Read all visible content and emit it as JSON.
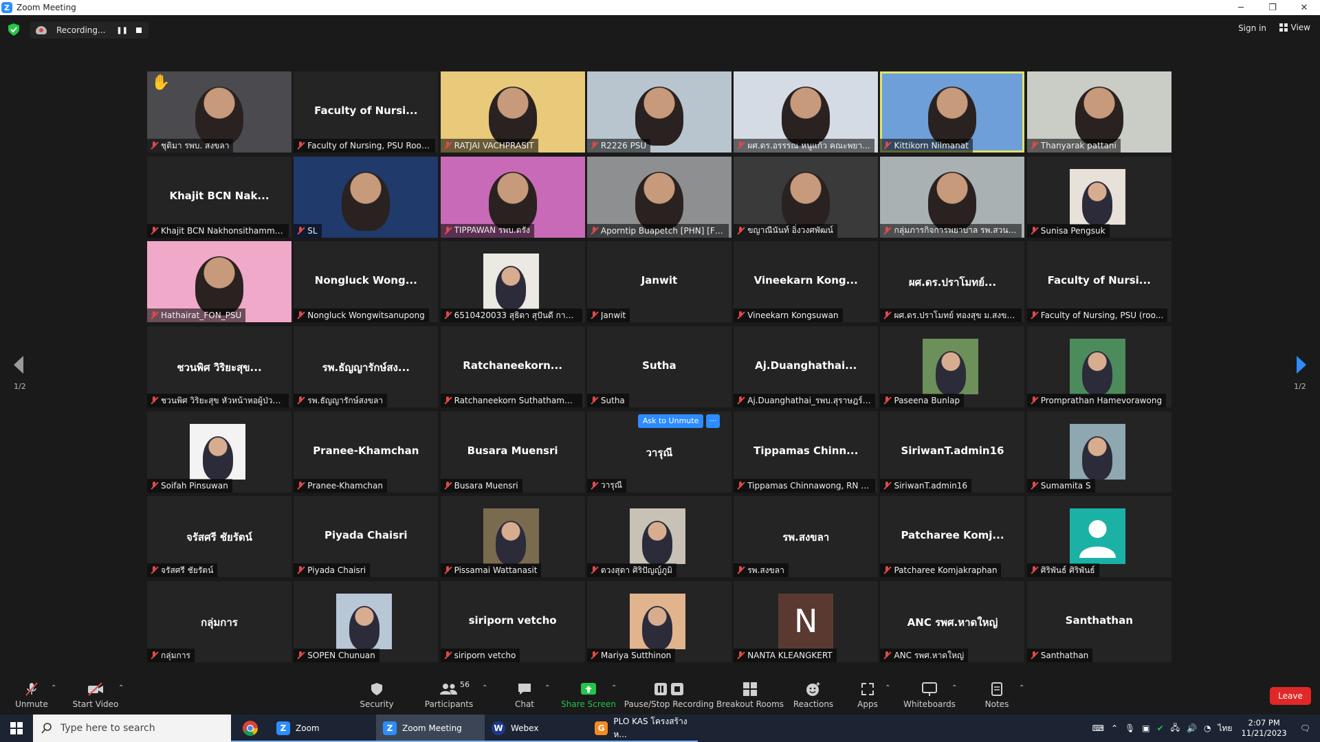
{
  "window": {
    "title": "Zoom Meeting",
    "controls": [
      "─",
      "❐",
      "✕"
    ]
  },
  "topbar": {
    "recording_label": "Recording...",
    "sign_in": "Sign in",
    "view": "View"
  },
  "tiles": [
    {
      "big": "",
      "label": "ชุติมา รพบ. สงขลา",
      "bg": "#4b4a4f",
      "kind": "video"
    },
    {
      "big": "Faculty of Nursi...",
      "label": "Faculty of Nursing, PSU Room...",
      "bg": "#242424",
      "kind": "name"
    },
    {
      "big": "",
      "label": "RATJAI VACHPRASIT",
      "bg": "#e9c97a",
      "kind": "video"
    },
    {
      "big": "",
      "label": "R2226 PSU",
      "bg": "#b8c5ce",
      "kind": "video"
    },
    {
      "big": "",
      "label": "ผศ.ดร.อรรรณ หนูแก้ว คณะพยา...",
      "bg": "#d5dbe5",
      "kind": "video"
    },
    {
      "big": "",
      "label": "Kittikorn Nilmanat",
      "bg": "#6f9fd8",
      "kind": "video",
      "active": true
    },
    {
      "big": "",
      "label": "Thanyarak pattani",
      "bg": "#c9cdc6",
      "kind": "video"
    },
    {
      "big": "Khajit BCN Nak...",
      "label": "Khajit BCN Nakhonsithammarat",
      "bg": "#242424",
      "kind": "name"
    },
    {
      "big": "",
      "label": "SL",
      "bg": "#1f3a6b",
      "kind": "video"
    },
    {
      "big": "",
      "label": "TIPPAWAN รพบ.ตรัง",
      "bg": "#c86ab7",
      "kind": "video"
    },
    {
      "big": "",
      "label": "Aporntip Buapetch [PHN] [FO...",
      "bg": "#8d8f90",
      "kind": "video"
    },
    {
      "big": "",
      "label": "ขญาณีนันท์ อิ่งวงศพัฒน์",
      "bg": "#3a3a3a",
      "kind": "video"
    },
    {
      "big": "",
      "label": "กลุ่มภารกิจการพยาบาล รพ.สวนสร...",
      "bg": "#a9b1b3",
      "kind": "video"
    },
    {
      "big": "",
      "label": "Sunisa Pengsuk",
      "bg": "#242424",
      "kind": "photo",
      "pbg": "#e7e1da"
    },
    {
      "big": "",
      "label": "Hathairat_FON_PSU",
      "bg": "#f0a9c8",
      "kind": "video"
    },
    {
      "big": "Nongluck Wong...",
      "label": "Nongluck Wongwitsanupong",
      "bg": "#242424",
      "kind": "name"
    },
    {
      "big": "",
      "label": "6510420033 สุธิดา สุปันดี การผดุ...",
      "bg": "#242424",
      "kind": "photo",
      "pbg": "#ece8e2"
    },
    {
      "big": "Janwit",
      "label": "Janwit",
      "bg": "#242424",
      "kind": "name"
    },
    {
      "big": "Vineekarn Kong...",
      "label": "Vineekarn Kongsuwan",
      "bg": "#242424",
      "kind": "name"
    },
    {
      "big": "ผศ.ดร.ปราโมทย์...",
      "label": "ผศ.ดร.ปราโมทย์ ทองสุข ม.สงขลาน...",
      "bg": "#242424",
      "kind": "name"
    },
    {
      "big": "Faculty of Nursi...",
      "label": "Faculty of Nursing, PSU (roo...",
      "bg": "#242424",
      "kind": "name"
    },
    {
      "big": "ชวนพิศ วิริยะสุข...",
      "label": "ชวนพิศ วิริยะสุข หัวหน้าหอผู้ป่วยเ...",
      "bg": "#242424",
      "kind": "name"
    },
    {
      "big": "รพ.ธัญญารักษ์สง...",
      "label": "รพ.ธัญญารักษ์สงขลา",
      "bg": "#242424",
      "kind": "name"
    },
    {
      "big": "Ratchaneekorn...",
      "label": "Ratchaneekorn Suthathammar...",
      "bg": "#242424",
      "kind": "name"
    },
    {
      "big": "Sutha",
      "label": "Sutha",
      "bg": "#242424",
      "kind": "name"
    },
    {
      "big": "Aj.Duanghathai...",
      "label": "Aj.Duanghathai_รพบ.สุราษฎร์ธานี",
      "bg": "#242424",
      "kind": "name"
    },
    {
      "big": "",
      "label": "Paseena Bunlap",
      "bg": "#242424",
      "kind": "photo",
      "pbg": "#6d8f5a"
    },
    {
      "big": "",
      "label": "Promprathan Hamevorawong",
      "bg": "#242424",
      "kind": "photo",
      "pbg": "#4c8c5c"
    },
    {
      "big": "",
      "label": "Soifah Pinsuwan",
      "bg": "#242424",
      "kind": "photo",
      "pbg": "#f3f3f3"
    },
    {
      "big": "Pranee-Khamchan",
      "label": "Pranee-Khamchan",
      "bg": "#242424",
      "kind": "name"
    },
    {
      "big": "Busara Muensri",
      "label": "Busara Muensri",
      "bg": "#242424",
      "kind": "name"
    },
    {
      "big": "วารุณี",
      "label": "วารุณี",
      "bg": "#242424",
      "kind": "name",
      "ask": true
    },
    {
      "big": "Tippamas Chinn...",
      "label": "Tippamas Chinnawong, RN P...",
      "bg": "#242424",
      "kind": "name"
    },
    {
      "big": "SiriwanT.admin16",
      "label": "SiriwanT.admin16",
      "bg": "#242424",
      "kind": "name"
    },
    {
      "big": "",
      "label": "Sumamita S",
      "bg": "#242424",
      "kind": "photo",
      "pbg": "#8fa7b0"
    },
    {
      "big": "จรัสศรี ชัยรัตน์",
      "label": "จรัสศรี ชัยรัตน์",
      "bg": "#242424",
      "kind": "name"
    },
    {
      "big": "Piyada Chaisri",
      "label": "Piyada Chaisri",
      "bg": "#242424",
      "kind": "name"
    },
    {
      "big": "",
      "label": "Pissamai Wattanasit",
      "bg": "#242424",
      "kind": "photo",
      "pbg": "#7a6b4f"
    },
    {
      "big": "",
      "label": "ดวงสุดา ศิริปัญญ์ภูมิ",
      "bg": "#242424",
      "kind": "photo",
      "pbg": "#c8c1b6"
    },
    {
      "big": "รพ.สงขลา",
      "label": "รพ.สงขลา",
      "bg": "#242424",
      "kind": "name"
    },
    {
      "big": "Patcharee Komj...",
      "label": "Patcharee Komjakraphan",
      "bg": "#242424",
      "kind": "name"
    },
    {
      "big": "",
      "label": "ศิริพันธ์ ศิริพันธ์",
      "bg": "#242424",
      "kind": "avatar"
    },
    {
      "big": "กลุ่มการ",
      "label": "กลุ่มการ",
      "bg": "#242424",
      "kind": "name"
    },
    {
      "big": "",
      "label": "SOPEN Chunuan",
      "bg": "#242424",
      "kind": "photo",
      "pbg": "#b8c7d6"
    },
    {
      "big": "siriporn vetcho",
      "label": "siriporn vetcho",
      "bg": "#242424",
      "kind": "name"
    },
    {
      "big": "",
      "label": "Mariya Sutthinon",
      "bg": "#242424",
      "kind": "photo",
      "pbg": "#e2b48e"
    },
    {
      "big": "",
      "label": "NANTA KLEANGKERT",
      "bg": "#242424",
      "kind": "letter",
      "letter": "N"
    },
    {
      "big": "ANC รพศ.หาดใหญ่",
      "label": "ANC รพศ.หาดใหญ่",
      "bg": "#242424",
      "kind": "name"
    },
    {
      "big": "Santhathan",
      "label": "Santhathan",
      "bg": "#242424",
      "kind": "name"
    }
  ],
  "ask_to_unmute": "Ask to Unmute",
  "more_dots": "···",
  "page_indicator_left": "1/2",
  "page_indicator_right": "1/2",
  "toolbar": {
    "unmute": "Unmute",
    "start_video": "Start Video",
    "security": "Security",
    "participants": "Participants",
    "participants_count": "56",
    "chat": "Chat",
    "share_screen": "Share Screen",
    "pause_stop_recording": "Pause/Stop Recording",
    "breakout_rooms": "Breakout Rooms",
    "reactions": "Reactions",
    "apps": "Apps",
    "whiteboards": "Whiteboards",
    "notes": "Notes",
    "leave": "Leave"
  },
  "taskbar": {
    "search_placeholder": "Type here to search",
    "apps": [
      "Zoom",
      "Zoom Meeting",
      "Webex",
      "PLO KAS โครงสร้างห..."
    ],
    "lang": "ไทย",
    "time": "2:07 PM",
    "date": "11/21/2023"
  },
  "colors": {
    "accent": "#2d8cff",
    "leave": "#e02828",
    "active_border": "#dfe36b",
    "share_green": "#24c54a"
  }
}
